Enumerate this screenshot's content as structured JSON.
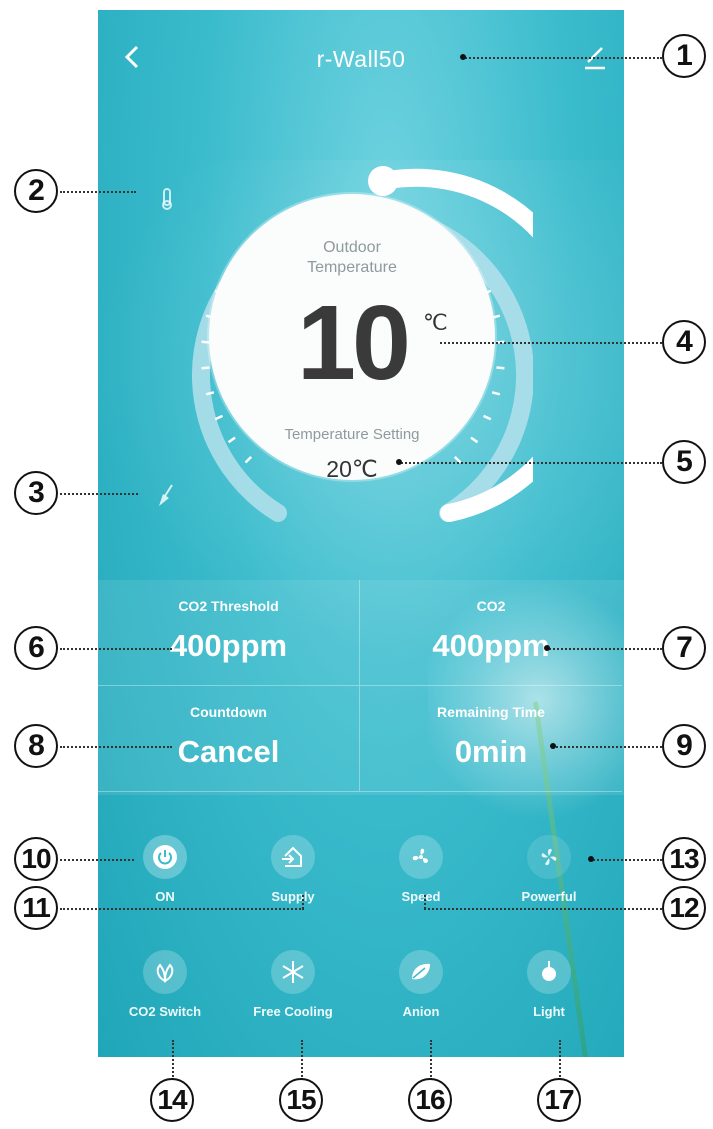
{
  "header": {
    "title": "r-Wall50",
    "back_icon": "chevron-left-icon",
    "edit_icon": "pencil-icon"
  },
  "side_icons": {
    "upper": "thermometer-icon",
    "lower": "broom-icon"
  },
  "dial": {
    "outdoor_label": "Outdoor Temperature",
    "outdoor_value": "10",
    "unit": "℃",
    "setting_label": "Temperature Setting",
    "setting_value": "20℃"
  },
  "stats": [
    {
      "label": "CO2 Threshold",
      "value": "400ppm"
    },
    {
      "label": "CO2",
      "value": "400ppm"
    },
    {
      "label": "Countdown",
      "value": "Cancel"
    },
    {
      "label": "Remaining Time",
      "value": "0min"
    }
  ],
  "functions_row1": [
    {
      "label": "ON",
      "icon": "power-icon"
    },
    {
      "label": "Supply",
      "icon": "supply-icon"
    },
    {
      "label": "Speed",
      "icon": "fan-icon"
    },
    {
      "label": "Powerful",
      "icon": "turbo-fan-icon"
    }
  ],
  "functions_row2": [
    {
      "label": "CO2 Switch",
      "icon": "leaf-icon"
    },
    {
      "label": "Free Cooling",
      "icon": "snowflake-icon"
    },
    {
      "label": "Anion",
      "icon": "anion-leaf-icon"
    },
    {
      "label": "Light",
      "icon": "bulb-icon"
    }
  ],
  "callouts": [
    "1",
    "2",
    "3",
    "4",
    "5",
    "6",
    "7",
    "8",
    "9",
    "10",
    "11",
    "12",
    "13",
    "14",
    "15",
    "16",
    "17"
  ],
  "colors": {
    "screen_bg": "#3bbccd",
    "dial_face": "#fbfdfd",
    "accent_ring": "#ffffff",
    "text_dark": "#3a3a3a"
  }
}
